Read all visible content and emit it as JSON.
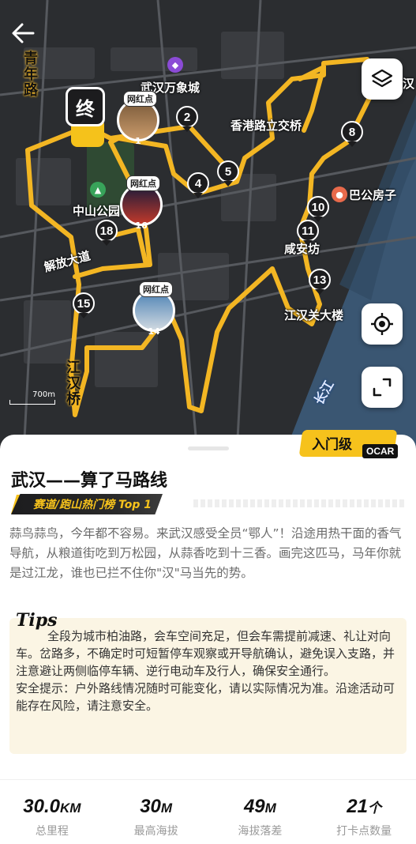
{
  "map": {
    "labels": {
      "road_qingnian": "青年路",
      "wanxiang": "武汉万象城",
      "hk_road": "香港路立交桥",
      "zhongshan_park": "中山公园",
      "jiefang_ave": "解放大道",
      "bagong": "巴公房子",
      "xianxiang": "咸安坊",
      "jianghan_bldg": "江汉关大楼",
      "jianghan_bridge": "江汉桥",
      "yangtze": "长江",
      "right_edge": "汉"
    },
    "pins": [
      "1",
      "2",
      "4",
      "5",
      "8",
      "10",
      "11",
      "13",
      "15",
      "18"
    ],
    "photo_pins": [
      {
        "tag": "网红点",
        "num": "1"
      },
      {
        "tag": "网红点",
        "num": "16"
      },
      {
        "tag": "网红点",
        "num": "14"
      }
    ],
    "end_marker": "终",
    "scale": "700m",
    "route_color": "#f3b623"
  },
  "sheet": {
    "level": "入门级",
    "brand": "OCAR",
    "title": "武汉——算了马路线",
    "rank": "赛道/跑山热门榜 Top 1",
    "intro": "蒜鸟蒜鸟，今年都不容易。来武汉感受全员“鄂人”！沿途用热干面的香气导航，从粮道街吃到万松园，从蒜香吃到十三香。画完这匹马，马年你就是过江龙，谁也已拦不住你\"汉\"马当先的势。",
    "tips": {
      "tag": "Tips",
      "body": "全段为城市柏油路，会车空间充足，但会车需提前减速、礼让对向车。岔路多，不确定时可短暂停车观察或开导航确认，避免误入支路，并注意避让两侧临停车辆、逆行电动车及行人，确保安全通行。",
      "safety": "安全提示：户外路线情况随时可能变化，请以实际情况为准。沿途活动可能存在风险，请注意安全。"
    },
    "stats": [
      {
        "value": "30.0",
        "unit": "KM",
        "label": "总里程"
      },
      {
        "value": "30",
        "unit": "M",
        "label": "最高海拔"
      },
      {
        "value": "49",
        "unit": "M",
        "label": "海拔落差"
      },
      {
        "value": "21",
        "unit": "个",
        "label": "打卡点数量"
      }
    ]
  }
}
